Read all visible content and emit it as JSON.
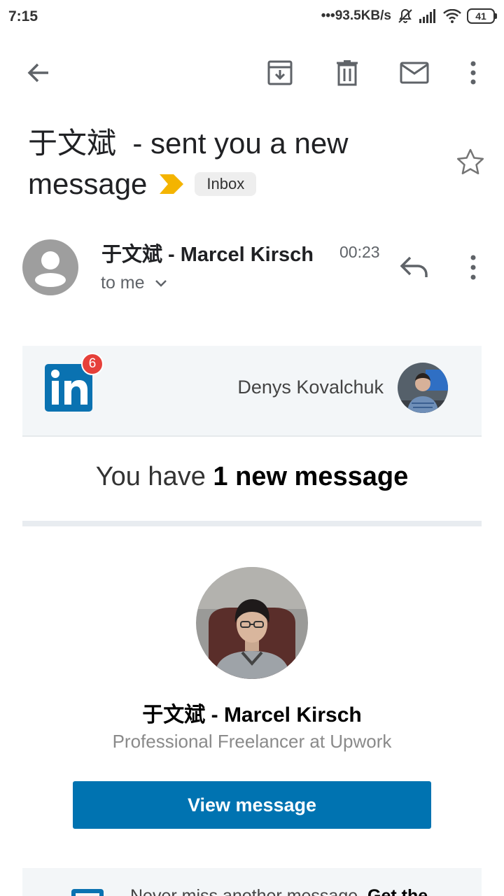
{
  "status_bar": {
    "time": "7:15",
    "network_speed": "93.5KB/s",
    "battery": "41"
  },
  "toolbar": {
    "icons": [
      "back-arrow-icon",
      "archive-icon",
      "delete-icon",
      "mark-unread-icon",
      "more-vert-icon"
    ]
  },
  "email": {
    "subject_line1": "于文斌  - sent you a new",
    "subject_line2": "message",
    "label": "Inbox",
    "importance_color": "#f4b400",
    "sender": "于文斌 - Marcel Kirsch",
    "time": "00:23",
    "recipient": "to me"
  },
  "body": {
    "notification_count": "6",
    "recipient_name": "Denys Kovalchuk",
    "headline_light": "You have ",
    "headline_bold": "1 new message",
    "sender_name": "于文斌 - Marcel Kirsch",
    "sender_headline": "Professional Freelancer at Upwork",
    "cta_label": "View message",
    "promo_text": "Never miss another message. ",
    "promo_bold": "Get the"
  },
  "colors": {
    "linkedin_blue": "#0073b1",
    "badge_red": "#e6403a",
    "avatar_gray": "#9e9e9e"
  }
}
